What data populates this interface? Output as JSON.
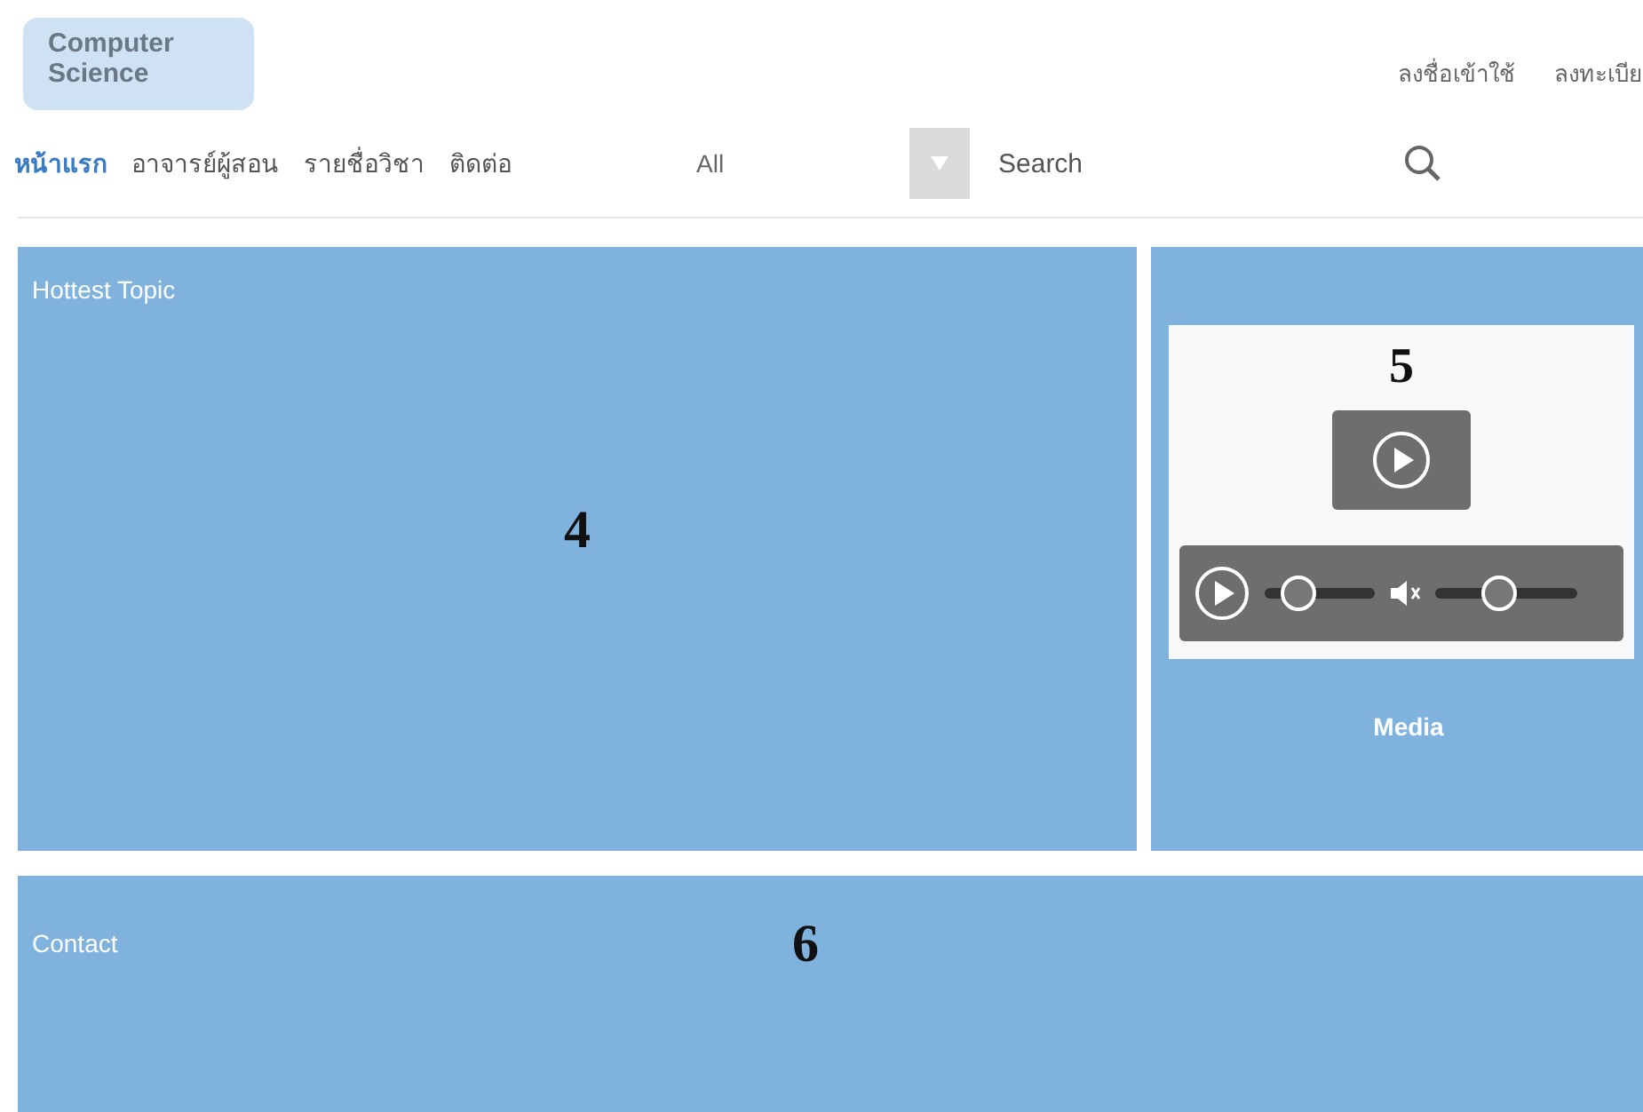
{
  "header": {
    "logo": "Computer Science",
    "links": [
      "ลงชื่อเข้าใช้",
      "ลงทะเบีย"
    ]
  },
  "nav": {
    "tabs": [
      {
        "label": "หน้าแรก",
        "selected": true
      },
      {
        "label": "อาจารย์ผู้สอน",
        "selected": false
      },
      {
        "label": "รายชื่อวิชา",
        "selected": false
      },
      {
        "label": "ติดต่อ",
        "selected": false
      }
    ],
    "filter": "All",
    "search": {
      "placeholder": "Search"
    }
  },
  "hottest": {
    "title": "Hottest Topic",
    "marker": "4"
  },
  "media": {
    "marker": "5",
    "title": "Media",
    "seek": {
      "level": 0.3
    },
    "volume": {
      "level": 0.45
    }
  },
  "contact": {
    "title": "Contact",
    "marker": "6"
  }
}
